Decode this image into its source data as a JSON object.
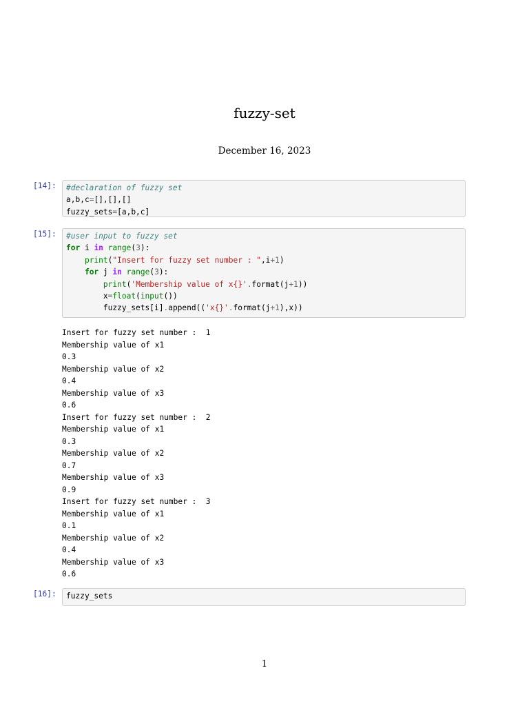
{
  "title": "fuzzy-set",
  "date": "December 16, 2023",
  "cells": [
    {
      "prompt": "[14]:",
      "lines": [
        [
          [
            "#declaration of fuzzy set",
            "c"
          ]
        ],
        [
          [
            "a,b,c",
            "n"
          ],
          [
            "=",
            "o"
          ],
          [
            "[],[],[]",
            "n"
          ]
        ],
        [
          [
            "fuzzy_sets",
            "n"
          ],
          [
            "=",
            "o"
          ],
          [
            "[a,b,c]",
            "n"
          ]
        ]
      ]
    },
    {
      "prompt": "[15]:",
      "lines": [
        [
          [
            "#user input to fuzzy set",
            "c"
          ]
        ],
        [
          [
            "for",
            "k"
          ],
          [
            " i ",
            "n"
          ],
          [
            "in",
            "kw"
          ],
          [
            " ",
            "n"
          ],
          [
            "range",
            "b"
          ],
          [
            "(",
            "n"
          ],
          [
            "3",
            "m"
          ],
          [
            "):",
            "n"
          ]
        ],
        [
          [
            "    ",
            "n"
          ],
          [
            "print",
            "b"
          ],
          [
            "(",
            "n"
          ],
          [
            "\"Insert for fuzzy set number : \"",
            "s"
          ],
          [
            ",i",
            "n"
          ],
          [
            "+",
            "o"
          ],
          [
            "1",
            "m"
          ],
          [
            ")",
            "n"
          ]
        ],
        [
          [
            "    ",
            "n"
          ],
          [
            "for",
            "k"
          ],
          [
            " j ",
            "n"
          ],
          [
            "in",
            "kw"
          ],
          [
            " ",
            "n"
          ],
          [
            "range",
            "b"
          ],
          [
            "(",
            "n"
          ],
          [
            "3",
            "m"
          ],
          [
            "):",
            "n"
          ]
        ],
        [
          [
            "        ",
            "n"
          ],
          [
            "print",
            "b"
          ],
          [
            "(",
            "n"
          ],
          [
            "'Membership value of x{}'",
            "s"
          ],
          [
            ".",
            "o"
          ],
          [
            "format(j",
            "n"
          ],
          [
            "+",
            "o"
          ],
          [
            "1",
            "m"
          ],
          [
            "))",
            "n"
          ]
        ],
        [
          [
            "        x",
            "n"
          ],
          [
            "=",
            "o"
          ],
          [
            "float",
            "b"
          ],
          [
            "(",
            "n"
          ],
          [
            "input",
            "b"
          ],
          [
            "())",
            "n"
          ]
        ],
        [
          [
            "        fuzzy_sets[i]",
            "n"
          ],
          [
            ".",
            "o"
          ],
          [
            "append((",
            "n"
          ],
          [
            "'x{}'",
            "s"
          ],
          [
            ".",
            "o"
          ],
          [
            "format(j",
            "n"
          ],
          [
            "+",
            "o"
          ],
          [
            "1",
            "m"
          ],
          [
            "),x))",
            "n"
          ]
        ]
      ]
    },
    {
      "prompt": "[16]:",
      "lines": [
        [
          [
            "fuzzy_sets",
            "n"
          ]
        ]
      ]
    }
  ],
  "output": [
    "Insert for fuzzy set number :  1",
    "Membership value of x1",
    "0.3",
    "Membership value of x2",
    "0.4",
    "Membership value of x3",
    "0.6",
    "Insert for fuzzy set number :  2",
    "Membership value of x1",
    "0.3",
    "Membership value of x2",
    "0.7",
    "Membership value of x3",
    "0.9",
    "Insert for fuzzy set number :  3",
    "Membership value of x1",
    "0.1",
    "Membership value of x2",
    "0.4",
    "Membership value of x3",
    "0.6"
  ],
  "page_number": "1"
}
